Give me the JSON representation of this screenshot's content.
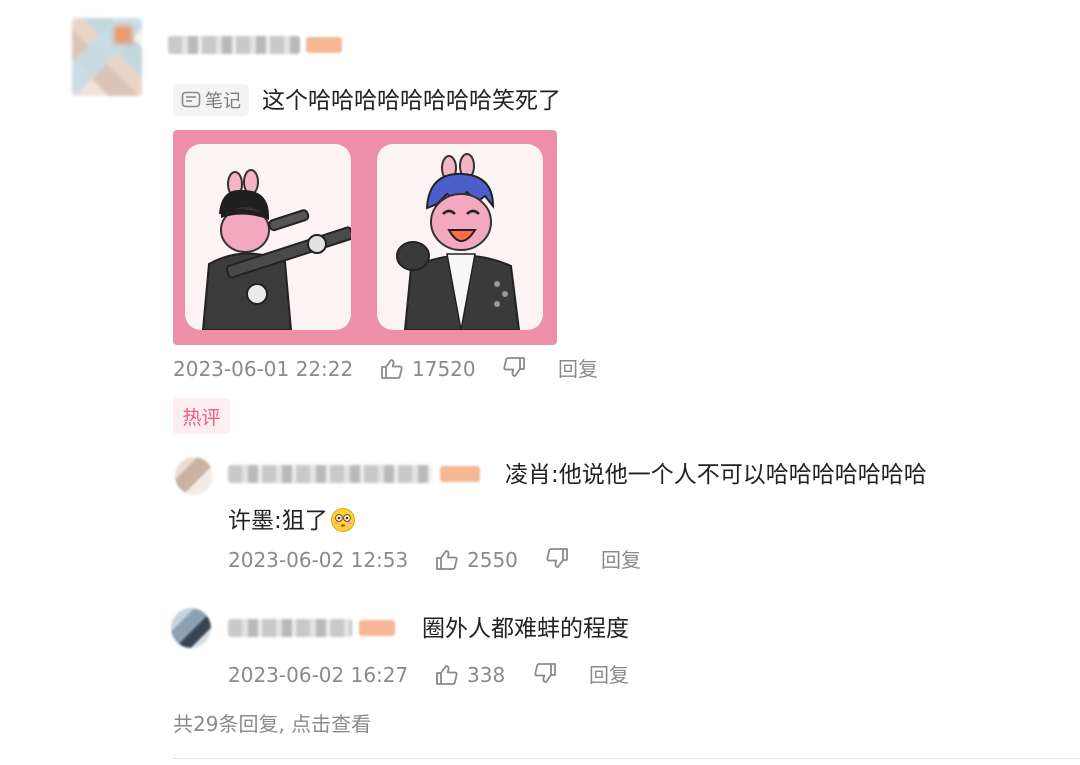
{
  "comment": {
    "note_tag_label": "笔记",
    "text": "这个哈哈哈哈哈哈哈哈笑死了",
    "timestamp": "2023-06-01 22:22",
    "like_count": "17520",
    "reply_label": "回复",
    "hot_badge": "热评"
  },
  "replies": [
    {
      "text_line1": "凌肖:他说他一个人不可以哈哈哈哈哈哈哈",
      "text_line2": "许墨:狙了",
      "emoji_icon": "flushed-face-icon",
      "timestamp": "2023-06-02 12:53",
      "like_count": "2550",
      "reply_label": "回复"
    },
    {
      "text": "圈外人都难蚌的程度",
      "timestamp": "2023-06-02 16:27",
      "like_count": "338",
      "reply_label": "回复"
    }
  ],
  "more_replies_text": "共29条回复, 点击查看",
  "colors": {
    "meta_gray": "#8a8a8a",
    "hot_pink": "#ef5c83",
    "sticker_pink": "#ee8fa9"
  }
}
